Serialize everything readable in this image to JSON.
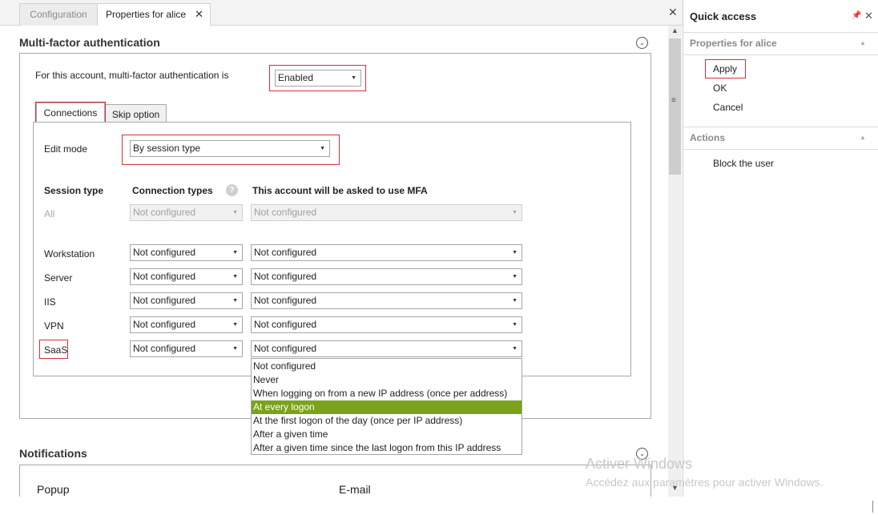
{
  "tabs": {
    "configuration": "Configuration",
    "properties": "Properties for alice",
    "close_glyph": "✕"
  },
  "mfa_section": {
    "title": "Multi-factor authentication",
    "status_label": "For this account, multi-factor authentication is",
    "status_value": "Enabled",
    "subtabs": [
      "Connections",
      "Skip option"
    ],
    "edit_mode_label": "Edit mode",
    "edit_mode_value": "By session type",
    "columns": {
      "session_type": "Session type",
      "connection_types": "Connection types",
      "ask_mfa": "This account will be asked to use MFA"
    },
    "rows": [
      {
        "session": "All",
        "connection": "Not configured",
        "mfa": "Not configured",
        "disabled": true
      },
      {
        "session": "Workstation",
        "connection": "Not configured",
        "mfa": "Not configured"
      },
      {
        "session": "Server",
        "connection": "Not configured",
        "mfa": "Not configured"
      },
      {
        "session": "IIS",
        "connection": "Not configured",
        "mfa": "Not configured"
      },
      {
        "session": "VPN",
        "connection": "Not configured",
        "mfa": "Not configured"
      },
      {
        "session": "SaaS",
        "connection": "Not configured",
        "mfa": "Not configured"
      }
    ],
    "dropdown_options": [
      "Not configured",
      "Never",
      "When logging on from a new IP address (once per address)",
      "At every logon",
      "At the first logon of the day (once per IP address)",
      "After a given time",
      "After a given time since the last logon from this IP address"
    ],
    "dropdown_selected_index": 3
  },
  "notifications": {
    "title": "Notifications",
    "popup_label": "Popup",
    "email_label": "E-mail"
  },
  "quick_access": {
    "title": "Quick access",
    "sections": [
      {
        "title": "Properties for alice",
        "items": [
          "Apply",
          "OK",
          "Cancel"
        ]
      },
      {
        "title": "Actions",
        "items": [
          "Block the user"
        ]
      }
    ]
  },
  "watermark": {
    "line1": "Activer Windows",
    "line2": "Accédez aux paramètres pour activer Windows."
  },
  "colors": {
    "highlight": "#d32f3a",
    "selected_option": "#7aa21a"
  }
}
